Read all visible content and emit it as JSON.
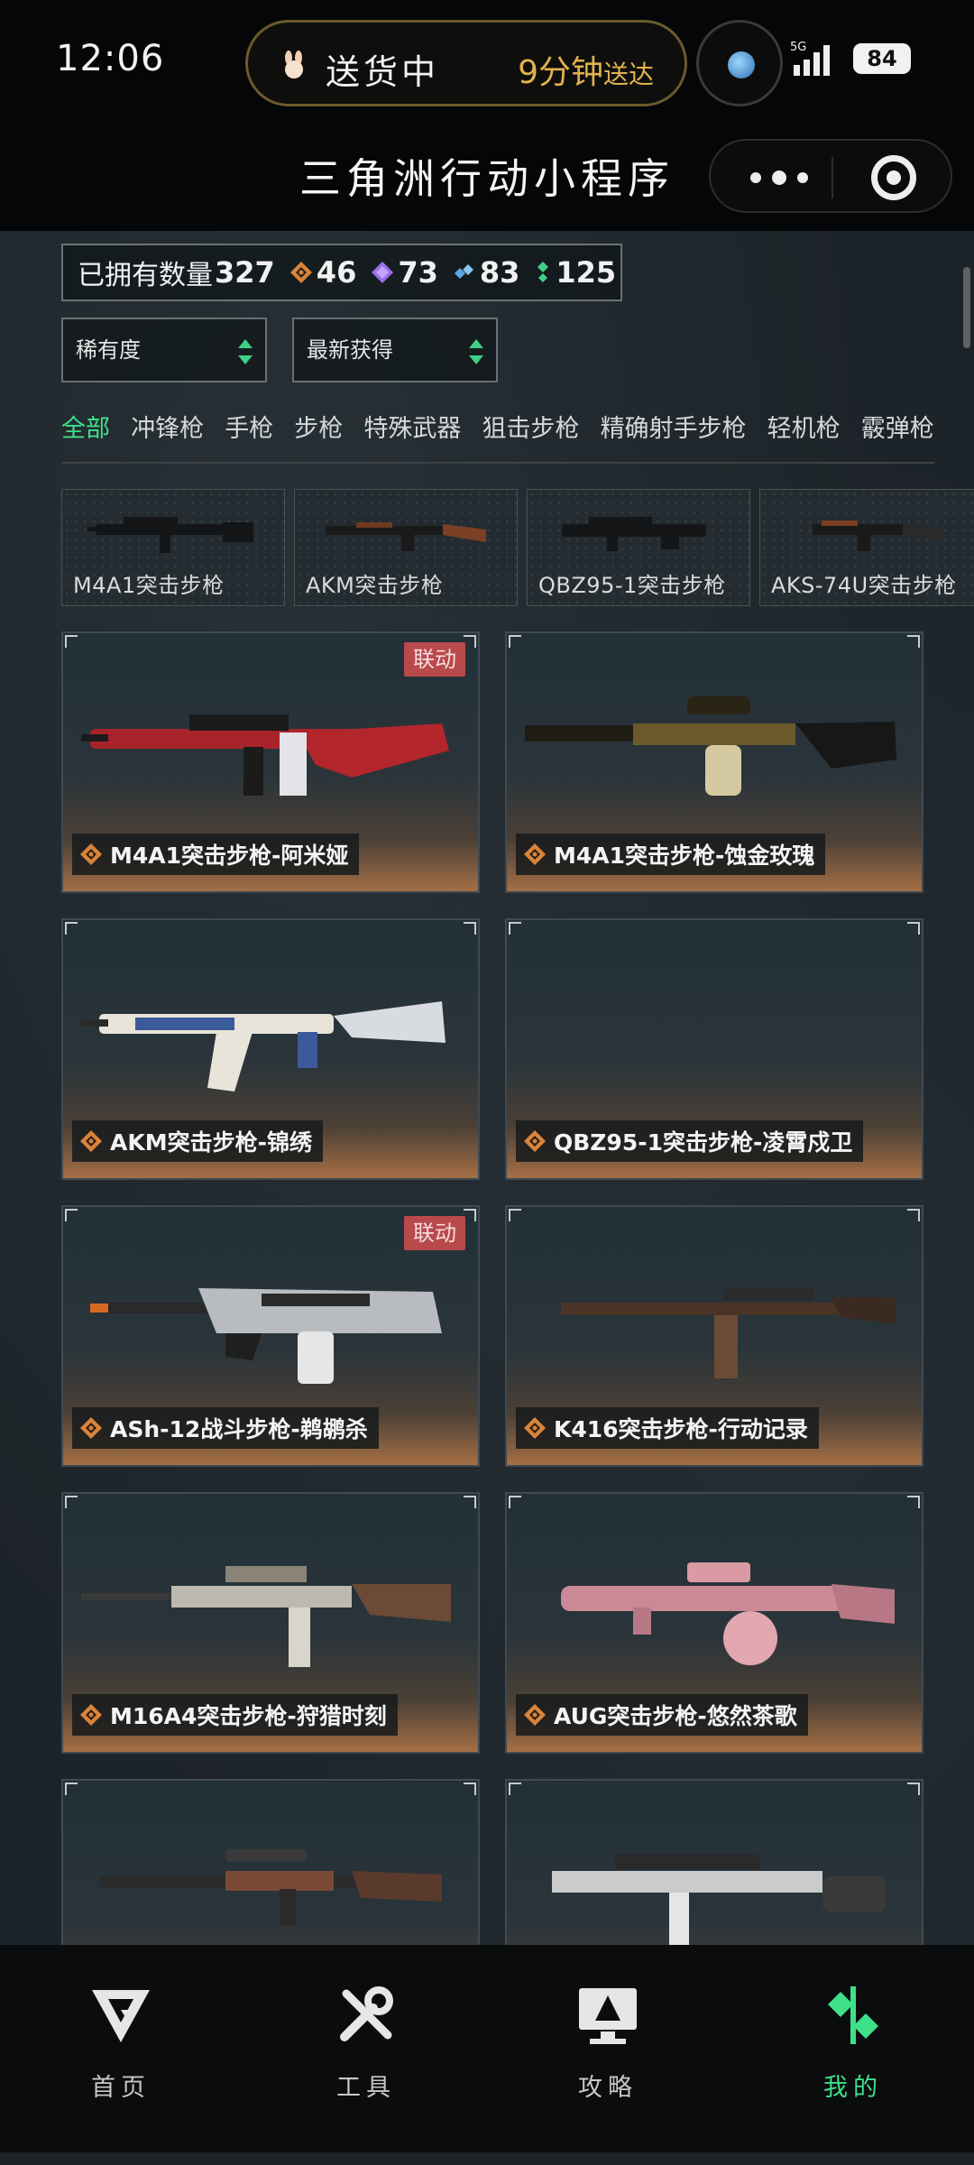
{
  "status": {
    "time": "12:06",
    "pill_left": "送货中",
    "pill_right_main": "9分钟",
    "pill_right_small": "送达",
    "network": "5G",
    "battery": "84"
  },
  "title": "三角洲行动小程序",
  "owned": {
    "label": "已拥有数量",
    "count": "327",
    "gems": [
      {
        "icon": "gold-diamond-icon",
        "color": "#d9843a",
        "value": "46"
      },
      {
        "icon": "purple-diamond-icon",
        "color": "#9a6ee8",
        "value": "73"
      },
      {
        "icon": "blue-diamond-icon",
        "color": "#5aa7e8",
        "value": "83"
      },
      {
        "icon": "green-diamond-icon",
        "color": "#3fcf86",
        "value": "125"
      }
    ]
  },
  "filters": {
    "rarity": "稀有度",
    "sort": "最新获得"
  },
  "tabs": [
    "全部",
    "冲锋枪",
    "手枪",
    "步枪",
    "特殊武器",
    "狙击步枪",
    "精确射手步枪",
    "轻机枪",
    "霰弹枪"
  ],
  "quick_weapons": [
    "M4A1突击步枪",
    "AKM突击步枪",
    "QBZ95-1突击步枪",
    "AKS-74U突击步枪"
  ],
  "cards": [
    {
      "name": "M4A1突击步枪-阿米娅",
      "tag": "联动",
      "color": "#a8242a"
    },
    {
      "name": "M4A1突击步枪-蚀金玫瑰",
      "tag": "",
      "color": "#6b5a2e"
    },
    {
      "name": "AKM突击步枪-锦绣",
      "tag": "",
      "color": "#3a5a9a"
    },
    {
      "name": "QBZ95-1突击步枪-凌霄戍卫",
      "tag": "",
      "color": ""
    },
    {
      "name": "ASh-12战斗步枪-鹈鹕杀",
      "tag": "联动",
      "color": "#b8bcc0"
    },
    {
      "name": "K416突击步枪-行动记录",
      "tag": "",
      "color": "#6b4a36"
    },
    {
      "name": "M16A4突击步枪-狩猎时刻",
      "tag": "",
      "color": "#bdb9ae"
    },
    {
      "name": "AUG突击步枪-悠然茶歌",
      "tag": "",
      "color": "#c98a95"
    },
    {
      "name": "",
      "tag": "",
      "color": "#7a4a36"
    },
    {
      "name": "",
      "tag": "",
      "color": "#c9cbcd"
    }
  ],
  "nav": [
    {
      "label": "首页",
      "icon": "home-icon"
    },
    {
      "label": "工具",
      "icon": "tools-icon"
    },
    {
      "label": "攻略",
      "icon": "guide-icon"
    },
    {
      "label": "我的",
      "icon": "profile-icon",
      "active": true
    }
  ]
}
